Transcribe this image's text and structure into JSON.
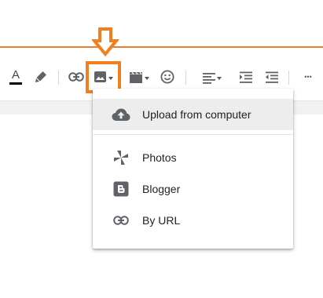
{
  "toolbar": {
    "items": [
      {
        "name": "text-color-icon",
        "glyph": "A"
      },
      {
        "name": "highlight-color-icon"
      },
      {
        "name": "insert-link-icon"
      },
      {
        "name": "insert-image-icon"
      },
      {
        "name": "insert-video-icon"
      },
      {
        "name": "insert-emoji-icon"
      },
      {
        "name": "align-icon"
      },
      {
        "name": "indent-increase-icon"
      },
      {
        "name": "indent-decrease-icon"
      },
      {
        "name": "more-options-icon",
        "glyph": "•••"
      }
    ],
    "text_color_underline": "#000000",
    "icon_color": "#5f6368"
  },
  "annotation": {
    "color": "#f0801f",
    "icons": [
      "down-arrow-icon"
    ]
  },
  "image_menu": {
    "items": [
      {
        "label": "Upload from computer",
        "icon": "cloud-upload-icon",
        "selected": true
      },
      {
        "label": "Photos",
        "icon": "photos-pinwheel-icon"
      },
      {
        "label": "Blogger",
        "icon": "blogger-logo-icon"
      },
      {
        "label": "By URL",
        "icon": "link-icon"
      }
    ]
  },
  "theme": {
    "accent": "#ef7d28",
    "menu_hover_bg": "#ededed"
  }
}
